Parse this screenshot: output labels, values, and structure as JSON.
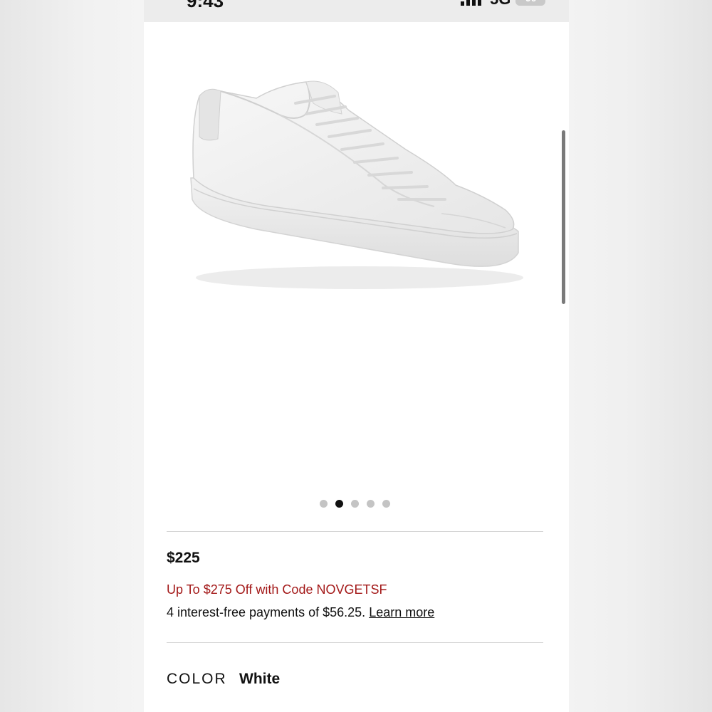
{
  "status_bar": {
    "time": "9:43",
    "network": "5G",
    "battery": "90"
  },
  "product": {
    "image_icon": "sneaker-image",
    "carousel": {
      "count": 5,
      "active_index": 1
    },
    "price": "$225",
    "promo": "Up To $275 Off with Code NOVGETSF",
    "installments_text": "4 interest-free payments of $56.25.",
    "learn_more_label": "Learn more",
    "color_label": "COLOR",
    "color_value": "White"
  }
}
